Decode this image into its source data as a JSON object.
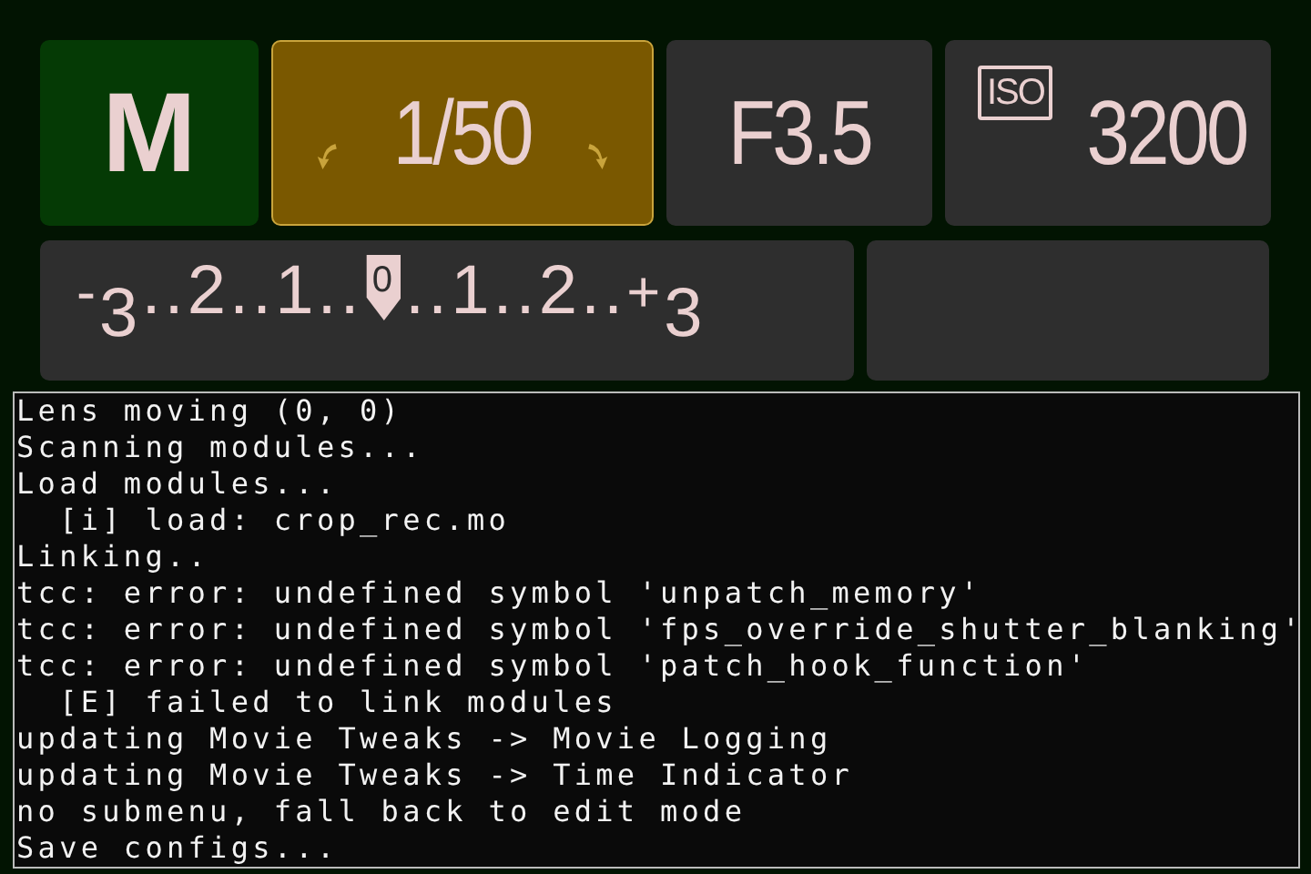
{
  "tiles": [
    {
      "kind": "mode",
      "value": "M",
      "selected": false
    },
    {
      "kind": "shutter",
      "value": "1/50",
      "selected": true
    },
    {
      "kind": "aperture",
      "value": "F3.5",
      "selected": false
    },
    {
      "kind": "iso",
      "badge": "ISO",
      "value": "3200",
      "selected": false
    }
  ],
  "exposure_scale": {
    "ticks": [
      {
        "text": "$^{-}$3",
        "selected": false
      },
      {
        "text": "..",
        "selected": false
      },
      {
        "text": "2",
        "selected": false
      },
      {
        "text": "..",
        "selected": false
      },
      {
        "text": "1",
        "selected": false
      },
      {
        "text": "..",
        "selected": false
      },
      {
        "text": "0",
        "selected": true
      },
      {
        "text": "..",
        "selected": false
      },
      {
        "text": "1",
        "selected": false
      },
      {
        "text": "..",
        "selected": false
      },
      {
        "text": "2",
        "selected": false
      },
      {
        "text": "..",
        "selected": false
      },
      {
        "text": "$^{+}$3",
        "selected": false
      }
    ]
  },
  "console": {
    "lines": [
      "Lens moving (0, 0)",
      "Scanning modules...",
      "Load modules...",
      "  [i] load: crop_rec.mo",
      "Linking..",
      "tcc: error: undefined symbol 'unpatch_memory'",
      "tcc: error: undefined symbol 'fps_override_shutter_blanking'",
      "tcc: error: undefined symbol 'patch_hook_function'",
      "  [E] failed to link modules",
      "updating Movie Tweaks -> Movie Logging",
      "updating Movie Tweaks -> Time Indicator",
      "no submenu, fall back to edit mode",
      "Save configs..."
    ]
  }
}
